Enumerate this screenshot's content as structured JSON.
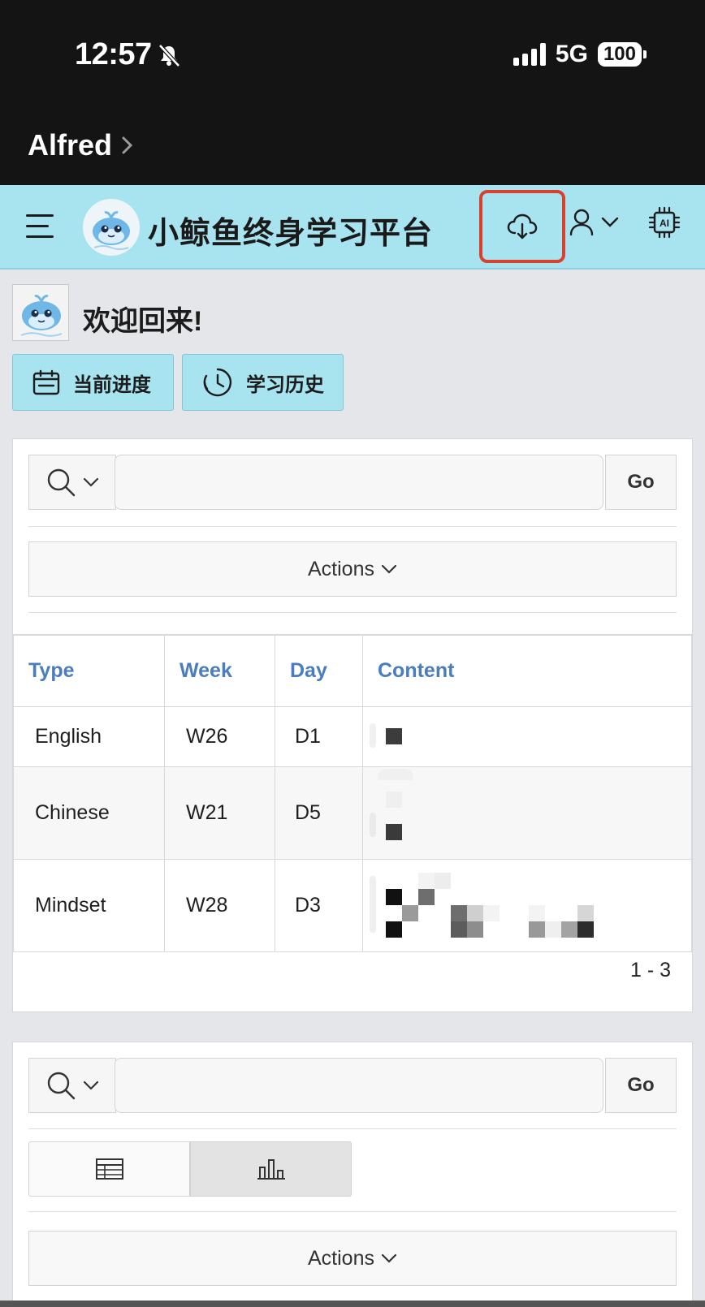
{
  "status_bar": {
    "time": "12:57",
    "network": "5G",
    "battery": "100",
    "back_app": "Alfred"
  },
  "header": {
    "title": "小鲸鱼终身学习平台",
    "icons": [
      "menu-icon",
      "whale-logo",
      "cloud-download-icon",
      "user-icon",
      "chevron-down-icon",
      "ai-chip-icon"
    ],
    "accent_color": "#a8e3f0",
    "highlight_color": "#d9412f"
  },
  "welcome": {
    "title": "欢迎回来!",
    "buttons": [
      {
        "label": "当前进度",
        "icon": "calendar-icon"
      },
      {
        "label": "学习历史",
        "icon": "history-clock-icon"
      }
    ]
  },
  "report1": {
    "search_placeholder": "",
    "go_label": "Go",
    "actions_label": "Actions",
    "columns": [
      "Type",
      "Week",
      "Day",
      "Content"
    ],
    "rows": [
      {
        "type": "English",
        "week": "W26",
        "day": "D1"
      },
      {
        "type": "Chinese",
        "week": "W21",
        "day": "D5"
      },
      {
        "type": "Mindset",
        "week": "W28",
        "day": "D3"
      }
    ],
    "pagination": "1 - 3"
  },
  "report2": {
    "search_placeholder": "",
    "go_label": "Go",
    "views": [
      "grid-view-icon",
      "chart-view-icon"
    ],
    "selected_view": "chart",
    "actions_label": "Actions"
  }
}
